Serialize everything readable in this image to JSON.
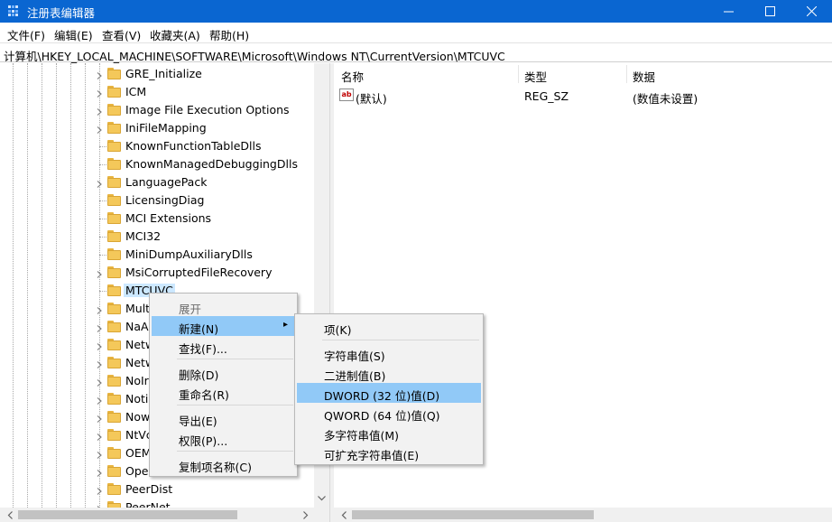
{
  "window": {
    "title": "注册表编辑器",
    "minimize_icon": "minimize-icon",
    "maximize_icon": "maximize-icon",
    "close_icon": "close-icon"
  },
  "menubar": {
    "items": [
      "文件(F)",
      "编辑(E)",
      "查看(V)",
      "收藏夹(A)",
      "帮助(H)"
    ]
  },
  "address": {
    "path": "计算机\\HKEY_LOCAL_MACHINE\\SOFTWARE\\Microsoft\\Windows NT\\CurrentVersion\\MTCUVC"
  },
  "tree": {
    "items": [
      {
        "label": "GRE_Initialize",
        "expandable": true
      },
      {
        "label": "ICM",
        "expandable": true
      },
      {
        "label": "Image File Execution Options",
        "expandable": true
      },
      {
        "label": "IniFileMapping",
        "expandable": true
      },
      {
        "label": "KnownFunctionTableDlls",
        "expandable": false
      },
      {
        "label": "KnownManagedDebuggingDlls",
        "expandable": false
      },
      {
        "label": "LanguagePack",
        "expandable": true
      },
      {
        "label": "LicensingDiag",
        "expandable": false
      },
      {
        "label": "MCI Extensions",
        "expandable": false
      },
      {
        "label": "MCI32",
        "expandable": false
      },
      {
        "label": "MiniDumpAuxiliaryDlls",
        "expandable": false
      },
      {
        "label": "MsiCorruptedFileRecovery",
        "expandable": true
      },
      {
        "label": "MTCUVC",
        "expandable": false,
        "selected": true
      },
      {
        "label": "Mult",
        "expandable": true
      },
      {
        "label": "NaA",
        "expandable": true
      },
      {
        "label": "Netw",
        "expandable": true
      },
      {
        "label": "Netw",
        "expandable": true
      },
      {
        "label": "NoIr",
        "expandable": true
      },
      {
        "label": "Noti",
        "expandable": true
      },
      {
        "label": "Now",
        "expandable": true
      },
      {
        "label": "NtVc",
        "expandable": true
      },
      {
        "label": "OEM",
        "expandable": true
      },
      {
        "label": "Ope",
        "expandable": true
      },
      {
        "label": "PeerDist",
        "expandable": true
      },
      {
        "label": "PeerNet",
        "expandable": true
      }
    ]
  },
  "list": {
    "columns": [
      "名称",
      "类型",
      "数据"
    ],
    "rows": [
      {
        "icon": "string-value-icon",
        "icon_text": "ab",
        "name": "(默认)",
        "type": "REG_SZ",
        "data": "(数值未设置)"
      }
    ]
  },
  "context_menu": {
    "items": [
      {
        "label": "展开",
        "disabled": true
      },
      {
        "label": "新建(N)",
        "highlighted": true,
        "submenu": true
      },
      {
        "label": "查找(F)..."
      },
      {
        "label": "删除(D)"
      },
      {
        "label": "重命名(R)"
      },
      {
        "label": "导出(E)"
      },
      {
        "label": "权限(P)..."
      },
      {
        "label": "复制项名称(C)"
      }
    ]
  },
  "submenu": {
    "items": [
      {
        "label": "项(K)"
      },
      {
        "label": "字符串值(S)"
      },
      {
        "label": "二进制值(B)"
      },
      {
        "label": "DWORD (32 位)值(D)",
        "highlighted": true
      },
      {
        "label": "QWORD (64 位)值(Q)"
      },
      {
        "label": "多字符串值(M)"
      },
      {
        "label": "可扩充字符串值(E)"
      }
    ]
  },
  "colors": {
    "titlebar": "#0a66d1",
    "menu_highlight": "#91c9f7",
    "selection": "#cce8ff",
    "folder": "#f4c85a"
  }
}
